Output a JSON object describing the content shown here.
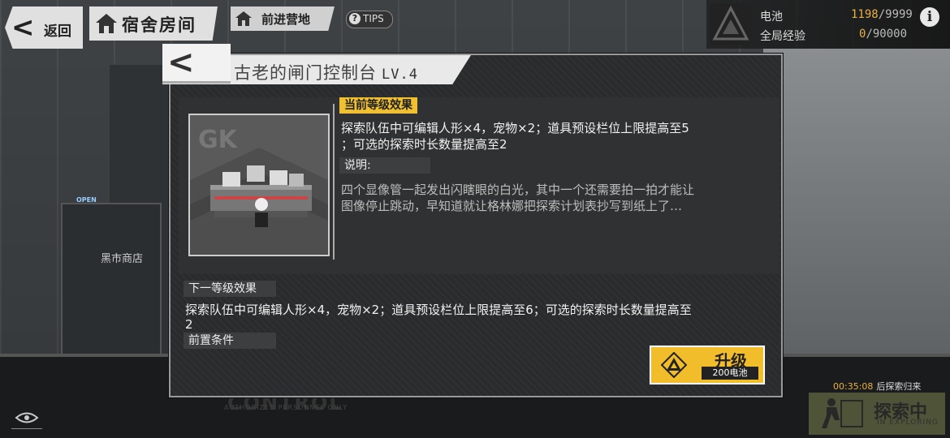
{
  "topbar": {
    "back_label": "返回",
    "room_label": "宿舍房间",
    "camp_label": "前进营地",
    "tips_label": "TIPS",
    "info_icon": "i"
  },
  "resources": {
    "battery_label": "电池",
    "battery_current": "1198",
    "battery_max": "/9999",
    "exp_label": "全局经验",
    "exp_current": "0",
    "exp_max": "/90000"
  },
  "scene": {
    "shop_label": "黑市商店",
    "open_sign": "OPEN",
    "control_text": "CONTROL",
    "control_sub": "AUTHORIZED PERSONNEL ONLY"
  },
  "dialog": {
    "title": "古老的闸门控制台",
    "level": "LV.4",
    "current_tag": "当前等级效果",
    "current_effect_line1": "探索队伍中可编辑人形×4，宠物×2；道具预设栏位上限提高至5",
    "current_effect_line2": "；可选的探索时长数量提高至2",
    "desc_tag": "说明:",
    "desc_line1": "四个显像管一起发出闪瞎眼的白光，其中一个还需要拍一拍才能让",
    "desc_line2": "图像停止跳动，早知道就让格林娜把探索计划表抄写到纸上了…",
    "next_tag": "下一等级效果",
    "next_effect_line1": "探索队伍中可编辑人形×4，宠物×2；道具预设栏位上限提高至6；可选的探索时长数量提高至",
    "next_effect_line2": "2",
    "prereq_tag": "前置条件",
    "upgrade_label": "升级",
    "upgrade_cost": "200电池"
  },
  "exploration": {
    "timer": "00:35:08",
    "timer_label": "后探索归来",
    "status_label": "探索中",
    "status_sub": "IN EXPLORING"
  },
  "colors": {
    "accent": "#f2bd2a",
    "panel": "#2a2b2c"
  }
}
